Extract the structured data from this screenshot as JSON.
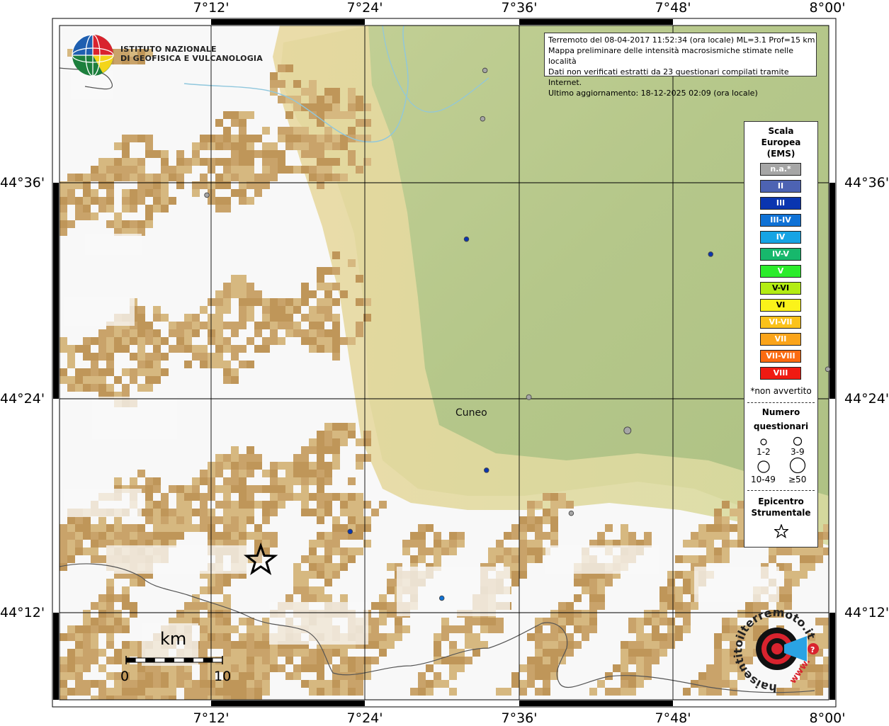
{
  "axes": {
    "lon_labels": [
      "7°12'",
      "7°24'",
      "7°36'",
      "7°48'",
      "8°00'"
    ],
    "lat_labels": [
      "44°36'",
      "44°24'",
      "44°12'"
    ]
  },
  "institute": {
    "line1": "ISTITUTO NAZIONALE",
    "line2": "DI GEOFISICA E VULCANOLOGIA"
  },
  "info": {
    "line1": "Terremoto del 08-04-2017 11:52:34 (ora locale) ML=3.1 Prof=15 km",
    "line2": "Mappa preliminare delle intensità macrosismiche stimate nelle località",
    "line3": "Dati non verificati estratti da 23 questionari compilati tramite Internet.",
    "line4": "Ultimo aggiornamento: 18-12-2025 02:09 (ora locale)"
  },
  "legend": {
    "title1": "Scala",
    "title2": "Europea",
    "title3": "(EMS)",
    "scale": [
      {
        "label": "n.a.*",
        "color": "#a6a6a6"
      },
      {
        "label": "II",
        "color": "#4d63b3"
      },
      {
        "label": "III",
        "color": "#0a35b0"
      },
      {
        "label": "III-IV",
        "color": "#0f72d6"
      },
      {
        "label": "IV",
        "color": "#16a4e4"
      },
      {
        "label": "IV-V",
        "color": "#17b86c"
      },
      {
        "label": "V",
        "color": "#2bec2b"
      },
      {
        "label": "V-VI",
        "color": "#b3ec14"
      },
      {
        "label": "VI",
        "color": "#fbf31a"
      },
      {
        "label": "VI-VII",
        "color": "#fbc21a"
      },
      {
        "label": "VII",
        "color": "#fba41a"
      },
      {
        "label": "VII-VIII",
        "color": "#fb6b11"
      },
      {
        "label": "VIII",
        "color": "#f01a12"
      }
    ],
    "na_note": "*non avvertito",
    "numero1": "Numero",
    "numero2": "questionari",
    "q_sizes": [
      "1-2",
      "3-9",
      "10-49",
      "≥50"
    ],
    "epi1": "Epicentro",
    "epi2": "Strumentale"
  },
  "map": {
    "city": "Cuneo",
    "scalebar": {
      "unit": "km",
      "start": "0",
      "end": "10"
    },
    "points": [
      {
        "lon": 7.5555,
        "lat": 44.7045,
        "intensity": "n.a.*",
        "questionnaires": "1-2"
      },
      {
        "lon": 7.5525,
        "lat": 44.6595,
        "intensity": "n.a.*",
        "questionnaires": "1-2"
      },
      {
        "lon": 7.1945,
        "lat": 44.5885,
        "intensity": "n.a.*",
        "questionnaires": "1-2"
      },
      {
        "lon": 7.5315,
        "lat": 44.5475,
        "intensity": "III",
        "questionnaires": "1-2"
      },
      {
        "lon": 7.8485,
        "lat": 44.5335,
        "intensity": "III",
        "questionnaires": "1-2"
      },
      {
        "lon": 8.0005,
        "lat": 44.4265,
        "intensity": "n.a.*",
        "questionnaires": "1-2"
      },
      {
        "lon": 7.9715,
        "lat": 44.3975,
        "intensity": "III",
        "questionnaires": "3-9"
      },
      {
        "lon": 7.6125,
        "lat": 44.4005,
        "intensity": "n.a.*",
        "questionnaires": "1-2"
      },
      {
        "lon": 7.7405,
        "lat": 44.3695,
        "intensity": "n.a.*",
        "questionnaires": "3-9"
      },
      {
        "lon": 7.5575,
        "lat": 44.3325,
        "intensity": "III",
        "questionnaires": "1-2"
      },
      {
        "lon": 7.6675,
        "lat": 44.2925,
        "intensity": "n.a.*",
        "questionnaires": "1-2"
      },
      {
        "lon": 7.3805,
        "lat": 44.2755,
        "intensity": "III",
        "questionnaires": "1-2"
      },
      {
        "lon": 7.4995,
        "lat": 44.2135,
        "intensity": "III-IV",
        "questionnaires": "1-2"
      }
    ],
    "epicenter": {
      "lon": 7.2645,
      "lat": 44.2485
    }
  },
  "logo": {
    "ring_text": "haisentitoilterremoto.it",
    "www_text": "www."
  },
  "colors": {
    "plain_green": "#b7c98a",
    "foothill_yellow": "#e6dc9a",
    "mountain_brown": "#c9a36a",
    "high_white": "#f8f8f8",
    "river_blue": "#8fc7dd",
    "border_gray": "#555555"
  }
}
